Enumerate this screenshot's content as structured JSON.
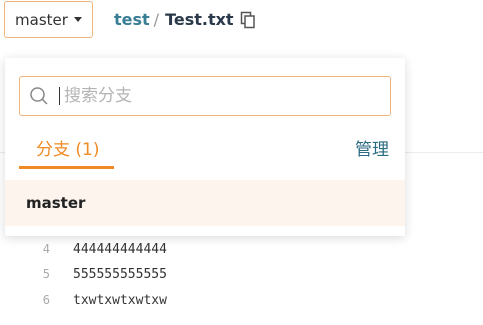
{
  "header": {
    "branch_label": "master",
    "repo": "test",
    "separator": "/",
    "file": "Test.txt"
  },
  "dropdown": {
    "search_placeholder": "搜索分支",
    "tab_branches": "分支 (1)",
    "manage_link": "管理",
    "branches": [
      "master"
    ]
  },
  "code": {
    "lines": [
      {
        "num": "4",
        "text": "444444444444"
      },
      {
        "num": "5",
        "text": "555555555555"
      },
      {
        "num": "6",
        "text": "txwtxwtxwtxw"
      }
    ]
  },
  "colors": {
    "accent": "#f08a24",
    "border_accent": "#f2b47d",
    "link": "#3a7d96",
    "selected_bg": "#fdf4ed"
  },
  "icons": {
    "copy": "copy-icon",
    "search": "search-icon",
    "caret": "caret-down-icon"
  }
}
